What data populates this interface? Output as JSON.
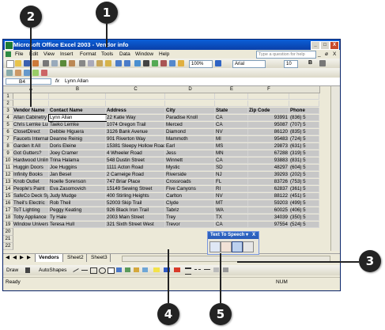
{
  "window": {
    "title": "Microsoft Office Excel 2003 - Vendor info",
    "controls": [
      "_",
      "□",
      "X"
    ]
  },
  "menu": {
    "items": [
      "File",
      "Edit",
      "View",
      "Insert",
      "Format",
      "Tools",
      "Data",
      "Window",
      "Help"
    ],
    "help_placeholder": "Type a question for help",
    "doc_controls": [
      "_",
      "ø",
      "X"
    ]
  },
  "toolbar": {
    "zoom": "100%",
    "font": "Arial",
    "font_size": "10",
    "bold": "B"
  },
  "formula_bar": {
    "name_box": "B4",
    "fx": "fx",
    "content": "Lynn Allan"
  },
  "sheet": {
    "columns": [
      "A",
      "B",
      "C",
      "D",
      "E",
      "F"
    ],
    "rows": [
      [
        "",
        "",
        "",
        "",
        "",
        "",
        ""
      ],
      [
        "",
        "",
        "",
        "",
        "",
        "",
        ""
      ],
      [
        "Vendor Name",
        "Contact Name",
        "Address",
        "City",
        "State",
        "Zip Code",
        "Phone"
      ],
      [
        "Allan Cabinetry",
        "Lynn Allan",
        "22 Katie Way",
        "Paradise Knoll",
        "CA",
        "93991",
        "(836) 5"
      ],
      [
        "Chris Lemke Lumber",
        "Taeko Lemke",
        "1074 Oregon Trail",
        "Merced",
        "CA",
        "95087",
        "(707) 5"
      ],
      [
        "ClosetDirect",
        "Debbie Higuera",
        "3126 Bank Avenue",
        "Diamond",
        "NV",
        "86120",
        "(835) 5"
      ],
      [
        "Faucets International",
        "Deanne Reinig",
        "901 Riverton Way",
        "Mammoth",
        "MI",
        "95483",
        "(724) 5"
      ],
      [
        "Garden It All",
        "Doris Eleine",
        "15381 Sleepy Hollow Road",
        "Earl",
        "MS",
        "29873",
        "(631) 5"
      ],
      [
        "Got Gutters?",
        "Joey Cramer",
        "4 Wheeler Road",
        "Jess",
        "MN",
        "67288",
        "(319) 5"
      ],
      [
        "Hardwood Unlimited",
        "Trina Halama",
        "548 Dustin Street",
        "Winnett",
        "CA",
        "93883",
        "(831) 5"
      ],
      [
        "Huggin Doors",
        "Joe Huggins",
        "1111 Acton Road",
        "Mystic",
        "SD",
        "48297",
        "(604) 5"
      ],
      [
        "Infinity Books",
        "Jan Besel",
        "2 Carneige Road",
        "Riverside",
        "NJ",
        "39293",
        "(202) 5"
      ],
      [
        "Knob Outlet",
        "Noelle Sorenson",
        "747 Briar Place",
        "Crossroads",
        "FL",
        "83726",
        "(753) 5"
      ],
      [
        "People's Paint",
        "Eva Zasomovich",
        "15149 Sewing Street",
        "Five Canyons",
        "RI",
        "62837",
        "(361) 5"
      ],
      [
        "SafeCo Deck Systems",
        "Judy Mudge",
        "400 Stirling Heights",
        "Carlton",
        "NV",
        "88122",
        "(451) 5"
      ],
      [
        "Theil's Electric",
        "Rob Theil",
        "52003 Skip Trail",
        "Clyde",
        "MT",
        "59203",
        "(499) 5"
      ],
      [
        "ToT Lighting",
        "Peggy Keating",
        "926 Black Iron Trail",
        "Tabriz",
        "WA",
        "60025",
        "(406) 5"
      ],
      [
        "Toby Appliance",
        "Ty Hale",
        "2003 Main Street",
        "Trey",
        "TX",
        "34039",
        "(350) 5"
      ],
      [
        "Window Universe",
        "Teresa Hull",
        "321 Sixth Street West",
        "Trevor",
        "CA",
        "97554",
        "(524) 5"
      ]
    ]
  },
  "sheet_tabs": [
    "Vendors",
    "Sheet2",
    "Sheet3"
  ],
  "draw_toolbar": {
    "draw": "Draw",
    "autoshapes": "AutoShapes"
  },
  "status": {
    "left": "Ready",
    "right": "NUM"
  },
  "text_to_speech": {
    "title": "Text To Speech",
    "close": "X"
  },
  "callouts": [
    "1",
    "2",
    "3",
    "4",
    "5"
  ]
}
